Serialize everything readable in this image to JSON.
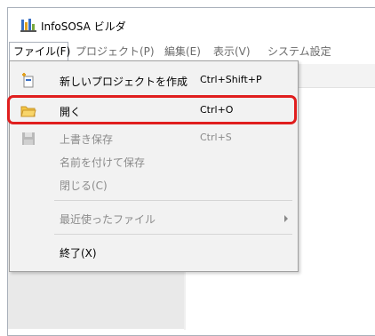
{
  "window": {
    "title": "InfoSOSA ビルダ"
  },
  "menubar": {
    "items": [
      {
        "label": "ファイル(F)"
      },
      {
        "label": "プロジェクト(P)"
      },
      {
        "label": "編集(E)"
      },
      {
        "label": "表示(V)"
      },
      {
        "label": "システム設定"
      }
    ]
  },
  "file_menu": {
    "items": [
      {
        "label": "新しいプロジェクトを作成",
        "shortcut": "Ctrl+Shift+P",
        "icon": "new-project-icon",
        "enabled": true
      },
      {
        "label": "開く",
        "shortcut": "Ctrl+O",
        "icon": "open-folder-icon",
        "enabled": true,
        "highlighted": true
      },
      {
        "label": "上書き保存",
        "shortcut": "Ctrl+S",
        "icon": "save-icon",
        "enabled": false
      },
      {
        "label": "名前を付けて保存",
        "shortcut": "",
        "enabled": false
      },
      {
        "label": "閉じる(C)",
        "shortcut": "",
        "enabled": false
      },
      {
        "label": "最近使ったファイル",
        "shortcut": "",
        "enabled": false,
        "submenu": true
      },
      {
        "label": "終了(X)",
        "shortcut": "",
        "enabled": true
      }
    ]
  },
  "colors": {
    "highlight_border": "#e01e1e"
  }
}
